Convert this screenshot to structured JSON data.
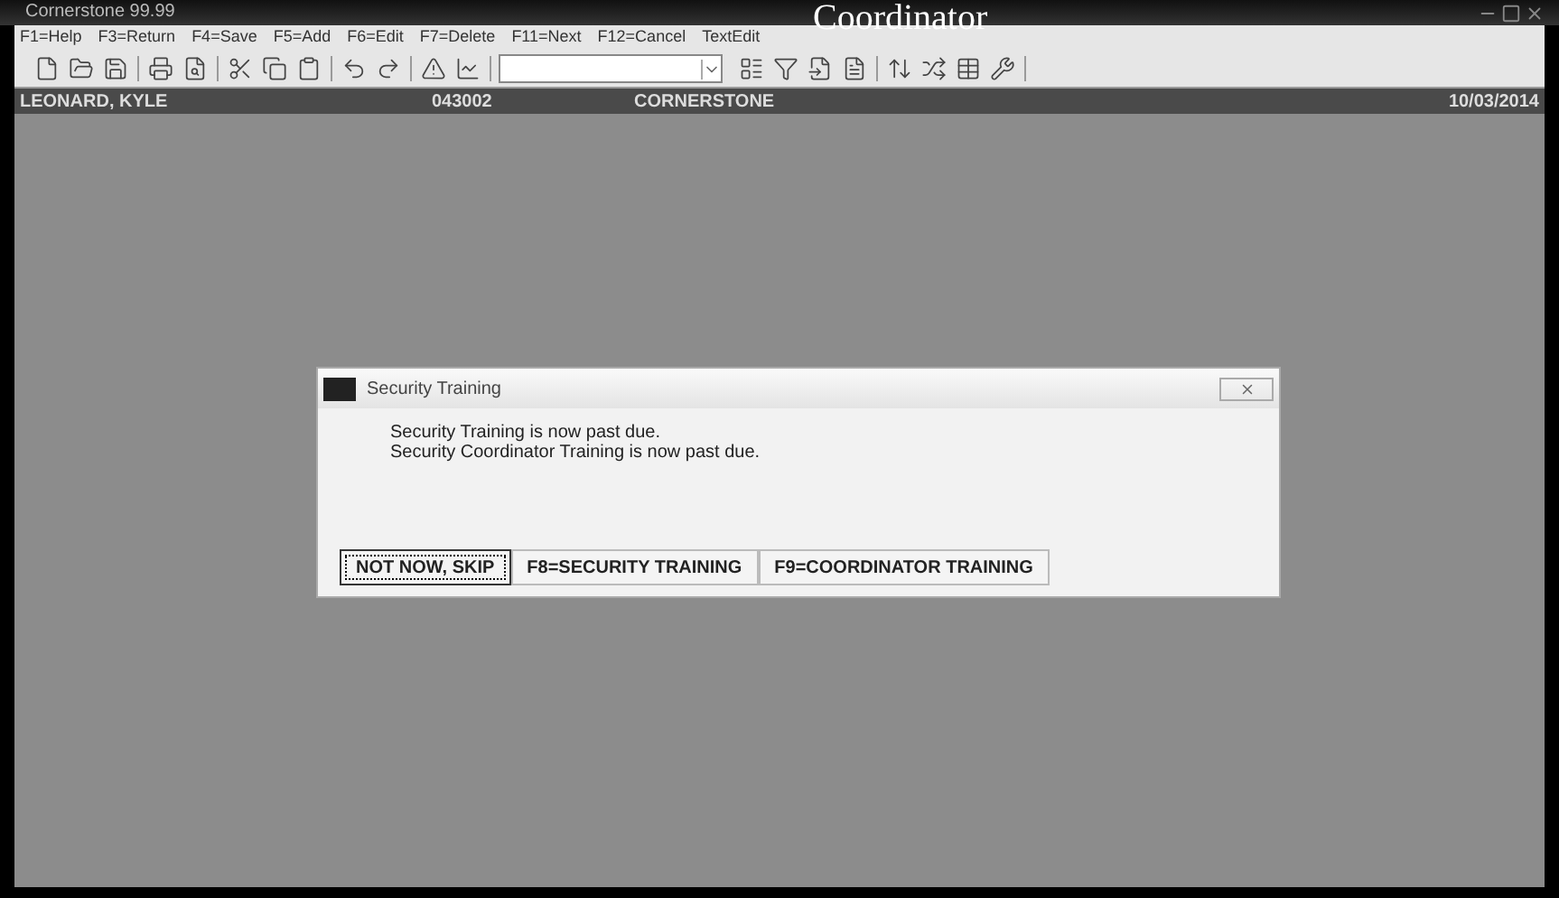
{
  "caption": "Coordinator",
  "window": {
    "title": "Cornerstone 99.99"
  },
  "menu": [
    "F1=Help",
    "F3=Return",
    "F4=Save",
    "F5=Add",
    "F6=Edit",
    "F7=Delete",
    "F11=Next",
    "F12=Cancel",
    "TextEdit"
  ],
  "status_bar": [
    "LEONARD, KYLE",
    "043002",
    "CORNERSTONE",
    "10/03/2014"
  ],
  "dialog": {
    "title": "Security Training",
    "messages": [
      "Security Training is now past due.",
      "Security Coordinator Training is now past due."
    ],
    "buttons": [
      {
        "label": "NOT NOW, SKIP",
        "selected": true
      },
      {
        "label": "F8=SECURITY TRAINING",
        "selected": false
      },
      {
        "label": "F9=COORDINATOR TRAINING",
        "selected": false
      }
    ]
  }
}
